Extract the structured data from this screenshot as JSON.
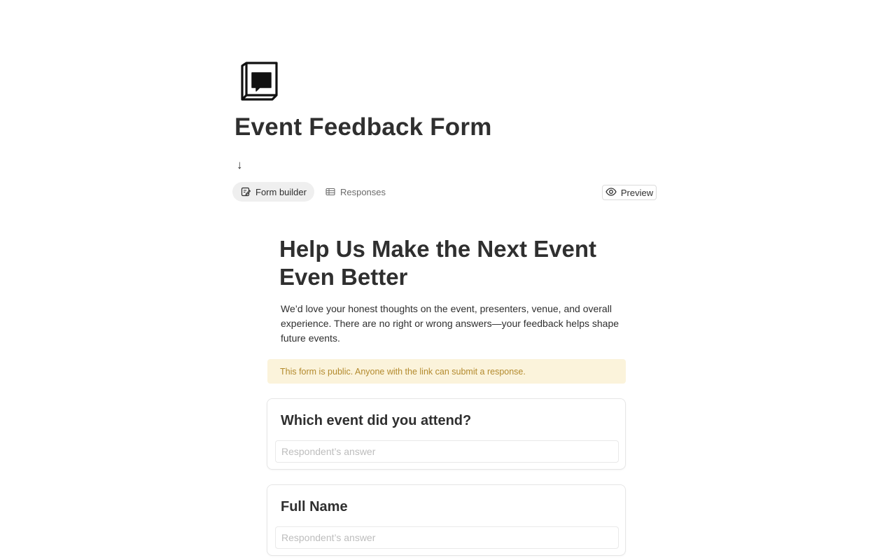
{
  "page": {
    "icon": "form-box-icon",
    "title": "Event Feedback Form",
    "arrow_glyph": "↓"
  },
  "tabs": [
    {
      "label": "Form builder",
      "icon": "form-edit-icon",
      "active": true
    },
    {
      "label": "Responses",
      "icon": "table-icon",
      "active": false
    }
  ],
  "preview": {
    "label": "Preview",
    "icon": "eye-icon"
  },
  "form": {
    "heading": "Help Us Make the Next Event Even Better",
    "description": "We’d love your honest thoughts on the event, presenters, venue, and overall experience. There are no right or wrong answers—your feedback helps shape future events.",
    "banner": "This form is public. Anyone with the link can submit a response.",
    "questions": [
      {
        "title": "Which event did you attend?",
        "placeholder": "Respondent’s answer"
      },
      {
        "title": "Full Name",
        "placeholder": "Respondent’s answer"
      }
    ]
  },
  "colors": {
    "banner_bg": "#fbf3db",
    "banner_text": "#b38a2d",
    "active_tab_bg": "#efefef"
  }
}
